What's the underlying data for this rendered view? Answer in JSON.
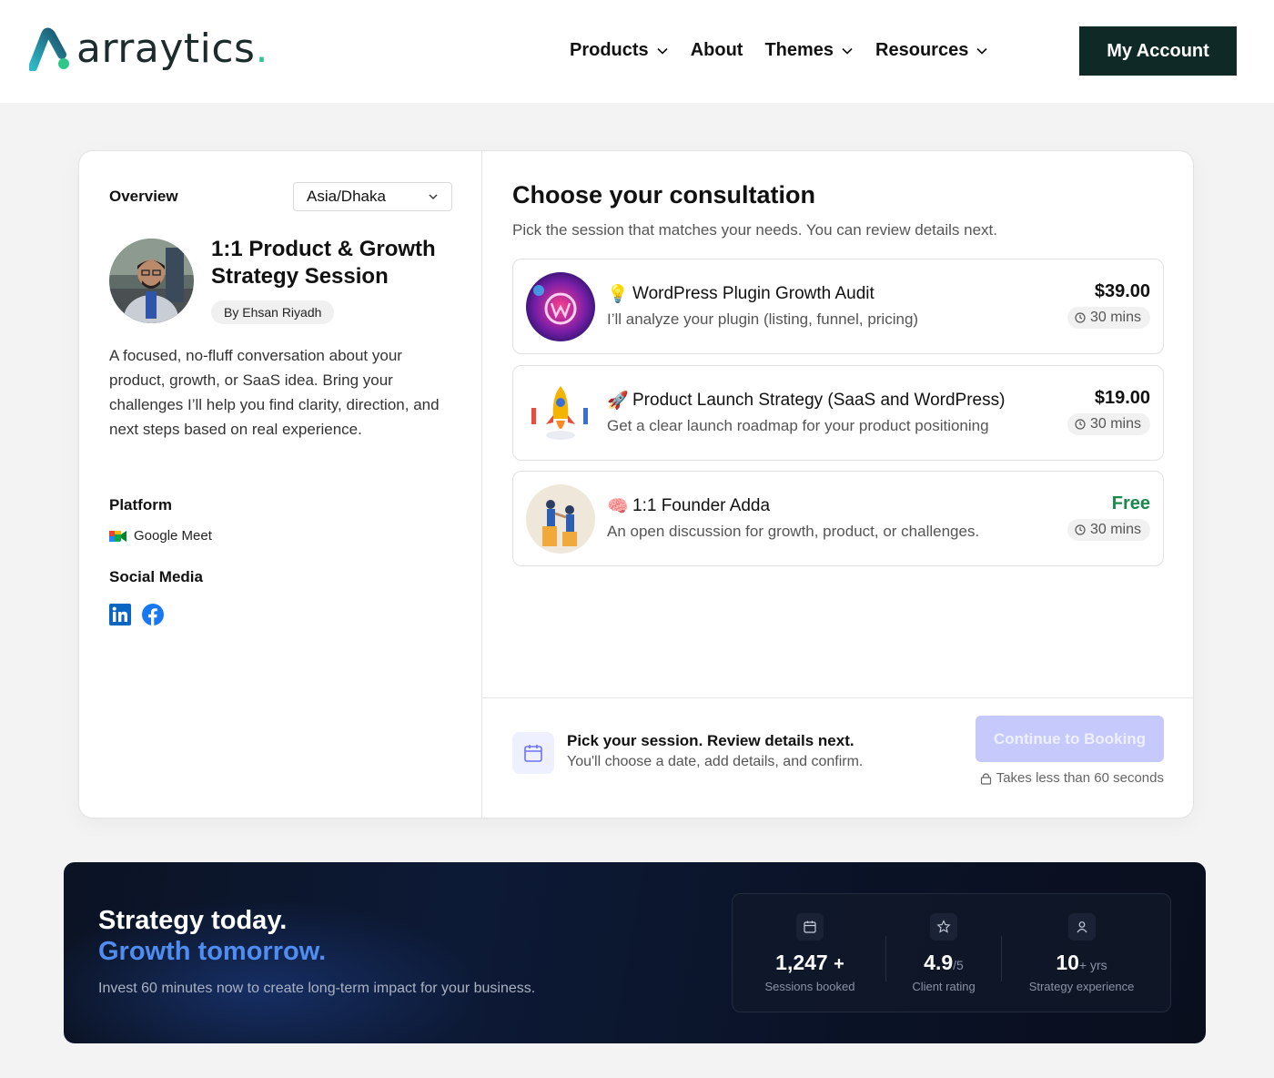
{
  "header": {
    "logo_text": "arraytics",
    "logo_dot": ".",
    "nav": [
      {
        "label": "Products",
        "has_dropdown": true
      },
      {
        "label": "About",
        "has_dropdown": false
      },
      {
        "label": "Themes",
        "has_dropdown": true
      },
      {
        "label": "Resources",
        "has_dropdown": true
      }
    ],
    "account_button": "My Account"
  },
  "overview": {
    "label": "Overview",
    "timezone": "Asia/Dhaka",
    "session_title": "1:1 Product & Growth Strategy Session",
    "host": "By Ehsan Riyadh",
    "description": "A focused, no-fluff conversation about your product, growth, or SaaS idea. Bring your challenges I’ll help you find clarity, direction, and next steps based on real experience.",
    "platform_label": "Platform",
    "platform_name": "Google Meet",
    "social_label": "Social Media",
    "social": [
      "linkedin-icon",
      "facebook-icon"
    ]
  },
  "consultation": {
    "title": "Choose your consultation",
    "subtitle": "Pick the session that matches your needs. You can review details next.",
    "options": [
      {
        "emoji": "💡",
        "title": "WordPress Plugin Growth Audit",
        "description": "I’ll analyze your plugin (listing, funnel, pricing)",
        "price": "$39.00",
        "duration": "30 mins"
      },
      {
        "emoji": "🚀",
        "title": "Product Launch Strategy (SaaS and WordPress)",
        "description": "Get a clear launch roadmap for your product positioning",
        "price": "$19.00",
        "duration": "30 mins"
      },
      {
        "emoji": "🧠",
        "title": "1:1 Founder Adda",
        "description": "An open discussion for growth, product, or challenges.",
        "price": "Free",
        "duration": "30 mins"
      }
    ],
    "footer_title": "Pick your session. Review details next.",
    "footer_sub": "You'll choose a date, add details, and confirm.",
    "continue_button": "Continue to Booking",
    "takes_note": "Takes less than 60 seconds"
  },
  "banner": {
    "line1": "Strategy today.",
    "line2": "Growth tomorrow.",
    "sub": "Invest 60 minutes now to create long-term impact for your business.",
    "stats": [
      {
        "value": "1,247",
        "suffix": "+",
        "label": "Sessions booked",
        "icon": "calendar-icon"
      },
      {
        "value": "4.9",
        "suffix": "/5",
        "label": "Client rating",
        "icon": "star-icon"
      },
      {
        "value": "10",
        "suffix": "+ yrs",
        "label": "Strategy experience",
        "icon": "user-icon"
      }
    ]
  },
  "colors": {
    "account_bg": "#0f2a26",
    "brand_green": "#2ec88a",
    "free_green": "#1a8a4a",
    "button_disabled": "#c6c9fb",
    "banner_accent": "#4f8ef0"
  }
}
